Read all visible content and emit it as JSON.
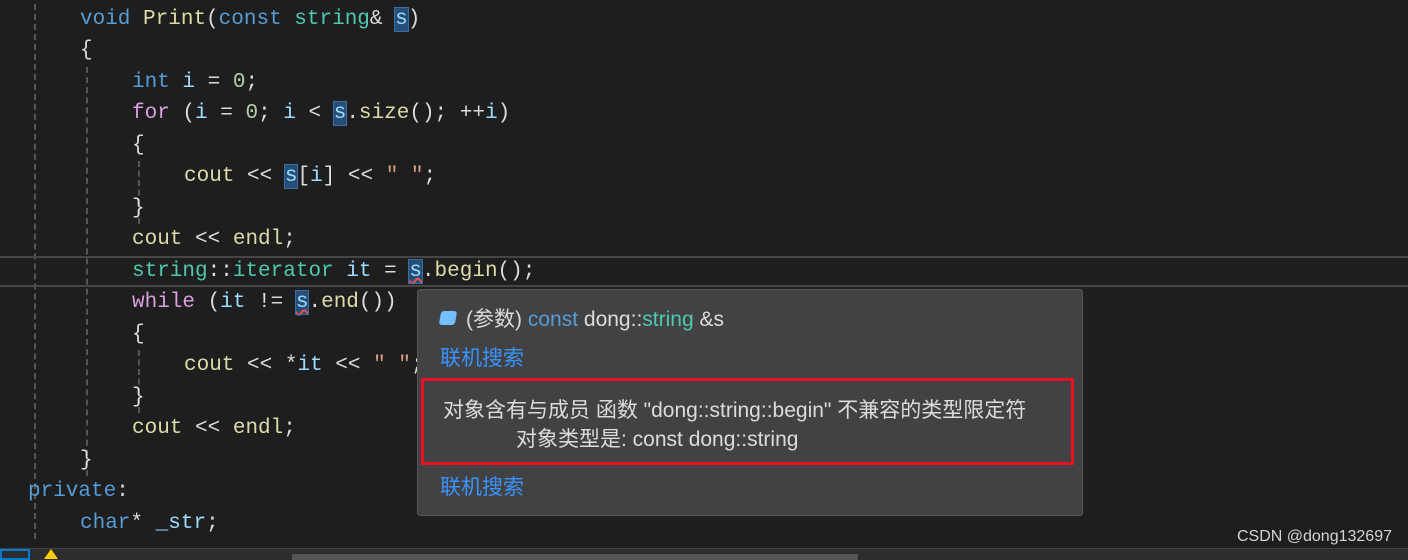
{
  "editor": {
    "lines": [
      {
        "indent": 1,
        "tokens": [
          {
            "t": "void",
            "c": "kw"
          },
          {
            "t": " "
          },
          {
            "t": "Print",
            "c": "fn"
          },
          {
            "t": "("
          },
          {
            "t": "const",
            "c": "kw"
          },
          {
            "t": " "
          },
          {
            "t": "string",
            "c": "type"
          },
          {
            "t": "& "
          },
          {
            "t": "s",
            "c": "ref"
          },
          {
            "t": ")"
          }
        ]
      },
      {
        "indent": 1,
        "tokens": [
          {
            "t": "{"
          }
        ]
      },
      {
        "indent": 2,
        "tokens": [
          {
            "t": "int",
            "c": "kw"
          },
          {
            "t": " "
          },
          {
            "t": "i",
            "c": "var"
          },
          {
            "t": " = "
          },
          {
            "t": "0",
            "c": "num"
          },
          {
            "t": ";"
          }
        ]
      },
      {
        "indent": 2,
        "tokens": [
          {
            "t": "for",
            "c": "ctrl"
          },
          {
            "t": " ("
          },
          {
            "t": "i",
            "c": "var"
          },
          {
            "t": " = "
          },
          {
            "t": "0",
            "c": "num"
          },
          {
            "t": "; "
          },
          {
            "t": "i",
            "c": "var"
          },
          {
            "t": " < "
          },
          {
            "t": "s",
            "c": "ref"
          },
          {
            "t": "."
          },
          {
            "t": "size",
            "c": "fn"
          },
          {
            "t": "(); ++"
          },
          {
            "t": "i",
            "c": "var"
          },
          {
            "t": ")"
          }
        ]
      },
      {
        "indent": 2,
        "tokens": [
          {
            "t": "{"
          }
        ]
      },
      {
        "indent": 3,
        "tokens": [
          {
            "t": "cout",
            "c": "fn"
          },
          {
            "t": " << "
          },
          {
            "t": "s",
            "c": "ref"
          },
          {
            "t": "["
          },
          {
            "t": "i",
            "c": "var"
          },
          {
            "t": "] << "
          },
          {
            "t": "\" \"",
            "c": "str"
          },
          {
            "t": ";"
          }
        ]
      },
      {
        "indent": 2,
        "tokens": [
          {
            "t": "}"
          }
        ]
      },
      {
        "indent": 2,
        "tokens": [
          {
            "t": "cout",
            "c": "fn"
          },
          {
            "t": " << "
          },
          {
            "t": "endl",
            "c": "fn"
          },
          {
            "t": ";"
          }
        ]
      },
      {
        "indent": 2,
        "current": true,
        "tokens": [
          {
            "t": "string",
            "c": "type"
          },
          {
            "t": "::"
          },
          {
            "t": "iterator",
            "c": "type"
          },
          {
            "t": " "
          },
          {
            "t": "it",
            "c": "var"
          },
          {
            "t": " = "
          },
          {
            "t": "s",
            "c": "ref err"
          },
          {
            "t": "."
          },
          {
            "t": "begin",
            "c": "fn"
          },
          {
            "t": "();"
          }
        ]
      },
      {
        "indent": 2,
        "tokens": [
          {
            "t": "while",
            "c": "ctrl"
          },
          {
            "t": " ("
          },
          {
            "t": "it",
            "c": "var"
          },
          {
            "t": " != "
          },
          {
            "t": "s",
            "c": "ref err"
          },
          {
            "t": "."
          },
          {
            "t": "end",
            "c": "fn"
          },
          {
            "t": "())"
          }
        ]
      },
      {
        "indent": 2,
        "tokens": [
          {
            "t": "{"
          }
        ]
      },
      {
        "indent": 3,
        "tokens": [
          {
            "t": "cout",
            "c": "fn"
          },
          {
            "t": " << *"
          },
          {
            "t": "it",
            "c": "var"
          },
          {
            "t": " << "
          },
          {
            "t": "\" \"",
            "c": "str"
          },
          {
            "t": ";"
          }
        ]
      },
      {
        "indent": 2,
        "tokens": [
          {
            "t": "}"
          }
        ]
      },
      {
        "indent": 2,
        "tokens": [
          {
            "t": "cout",
            "c": "fn"
          },
          {
            "t": " << "
          },
          {
            "t": "endl",
            "c": "fn"
          },
          {
            "t": ";"
          }
        ]
      },
      {
        "indent": 1,
        "tokens": [
          {
            "t": "}"
          }
        ]
      },
      {
        "indent": 0,
        "tokens": [
          {
            "t": "private",
            "c": "kw"
          },
          {
            "t": ":"
          }
        ]
      },
      {
        "indent": 1,
        "tokens": [
          {
            "t": "char",
            "c": "kw"
          },
          {
            "t": "* "
          },
          {
            "t": "_str",
            "c": "var"
          },
          {
            "t": ";"
          }
        ]
      }
    ]
  },
  "tooltip": {
    "icon": "parameter-icon",
    "sig_prefix": "(参数)",
    "sig_const": "const",
    "sig_ns": "dong::",
    "sig_type": "string",
    "sig_suffix": " &s",
    "link1": "联机搜索",
    "error_line1": "对象含有与成员 函数 \"dong::string::begin\" 不兼容的类型限定符",
    "error_line2": "对象类型是:  const dong::string",
    "link2": "联机搜索"
  },
  "watermark": "CSDN @dong132697",
  "colors": {
    "error_box": "#e81123",
    "link": "#3794ff",
    "keyword": "#569cd6",
    "type": "#4ec9b0"
  }
}
